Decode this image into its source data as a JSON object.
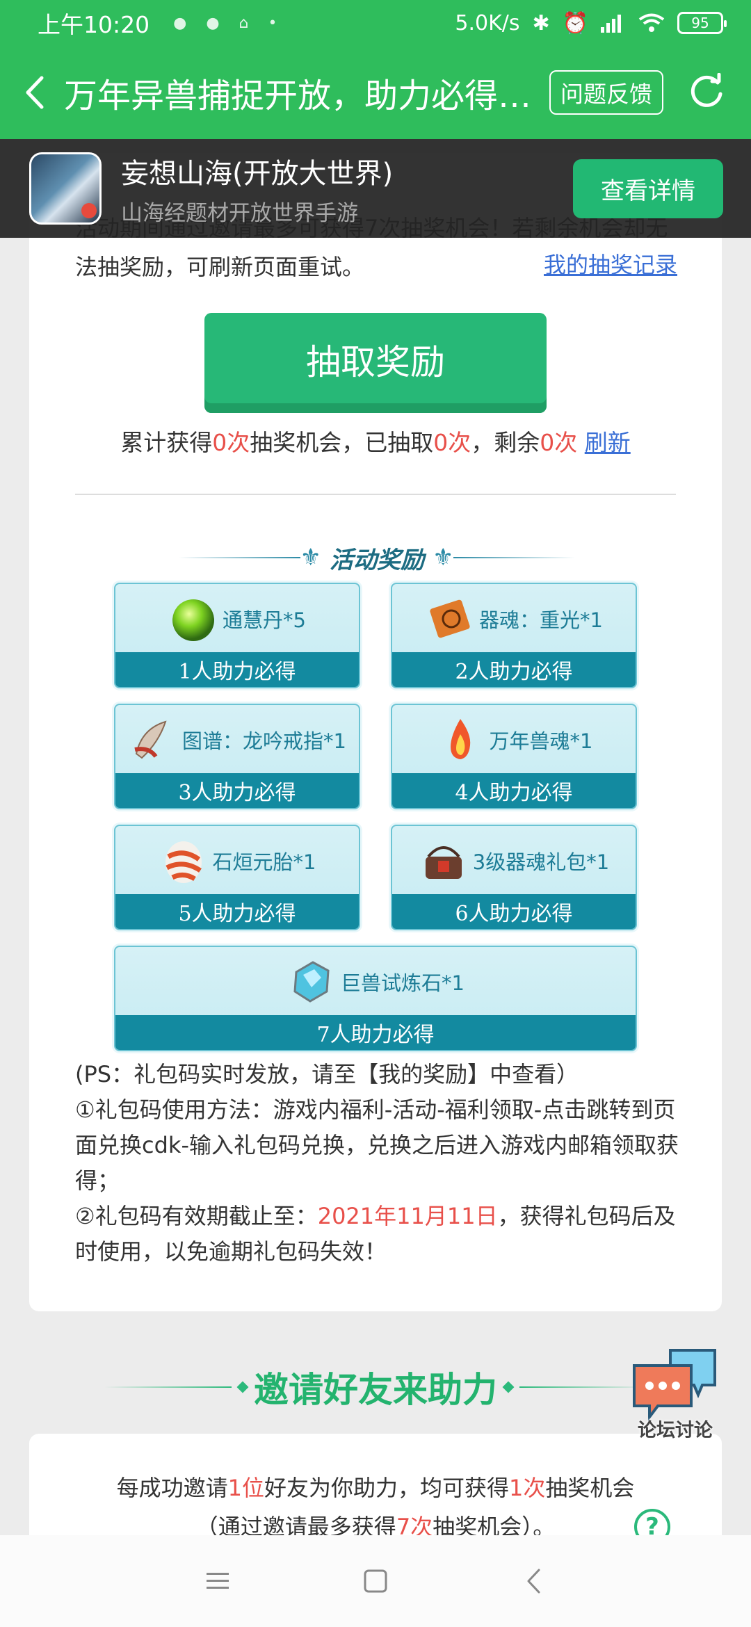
{
  "status_bar": {
    "time": "上午10:20",
    "speed": "5.0K/s",
    "battery": "95"
  },
  "title_bar": {
    "title": "万年异兽捕捉开放，助力必得…",
    "feedback_label": "问题反馈"
  },
  "app_banner": {
    "name": "妄想山海(开放大世界)",
    "subtitle": "山海经题材开放世界手游",
    "detail_label": "查看详情"
  },
  "lottery": {
    "notice": "活动期间通过邀请最多可获得7次抽奖机会！若剩余机会却无法抽奖励，可刷新页面重试。",
    "my_record": "我的抽奖记录",
    "draw_button": "抽取奖励",
    "stats_prefix": "累计获得",
    "total": "0次",
    "stats_mid1": "抽奖机会，已抽取",
    "drawn": "0次",
    "stats_mid2": "，剩余",
    "remaining": "0次",
    "refresh_link": "刷新"
  },
  "rewards": {
    "title": "活动奖励",
    "items": [
      {
        "name": "通慧丹*5",
        "condition": "1人助力必得",
        "icon": "green-orb-icon"
      },
      {
        "name": "器魂：重光*1",
        "condition": "2人助力必得",
        "icon": "scroll-icon"
      },
      {
        "name": "图谱：龙吟戒指*1",
        "condition": "3人助力必得",
        "icon": "blueprint-icon"
      },
      {
        "name": "万年兽魂*1",
        "condition": "4人助力必得",
        "icon": "flame-soul-icon"
      },
      {
        "name": "石烜元胎*1",
        "condition": "5人助力必得",
        "icon": "striped-egg-icon"
      },
      {
        "name": "3级器魂礼包*1",
        "condition": "6人助力必得",
        "icon": "basket-icon"
      },
      {
        "name": "巨兽试炼石*1",
        "condition": "7人助力必得",
        "icon": "crystal-stone-icon"
      }
    ]
  },
  "ps": {
    "line1": "(PS：礼包码实时发放，请至【我的奖励】中查看）",
    "line2": "①礼包码使用方法：游戏内福利-活动-福利领取-点击跳转到页面兑换cdk-输入礼包码兑换，兑换之后进入游戏内邮箱领取获得；",
    "line3_prefix": "②礼包码有效期截止至：",
    "expiry": "2021年11月11日",
    "line3_suffix": "，获得礼包码后及时使用，以免逾期礼包码失效！"
  },
  "invite": {
    "title": "邀请好友来助力",
    "t1": "每成功邀请",
    "n1": "1位",
    "t2": "好友为你助力，均可获得",
    "n2": "1次",
    "t3": "抽奖机会",
    "t4": "（通过邀请最多获得",
    "n3": "7次",
    "t5": "抽奖机会）。"
  },
  "forum": {
    "label": "论坛讨论"
  },
  "colors": {
    "brand_green": "#2fbd5c",
    "button_green": "#27b877",
    "highlight_red": "#e8504a",
    "reward_teal": "#138aa0"
  }
}
